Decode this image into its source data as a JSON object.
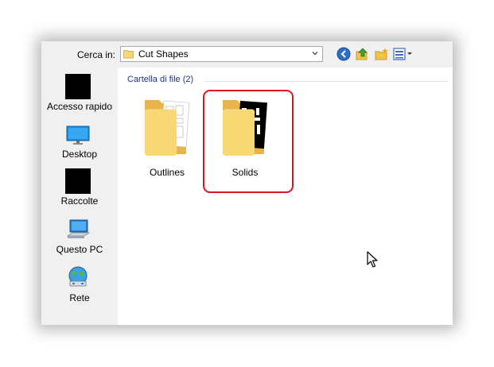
{
  "toolbar": {
    "look_in_label": "Cerca in:",
    "location_value": "Cut Shapes",
    "buttons": [
      "back-icon",
      "up-folder-icon",
      "new-folder-icon",
      "view-menu-icon"
    ]
  },
  "sidebar": {
    "items": [
      {
        "label": "Accesso rapido",
        "icon": "quick-access-icon"
      },
      {
        "label": "Desktop",
        "icon": "desktop-icon"
      },
      {
        "label": "Raccolte",
        "icon": "libraries-icon"
      },
      {
        "label": "Questo PC",
        "icon": "computer-icon"
      },
      {
        "label": "Rete",
        "icon": "network-icon"
      }
    ]
  },
  "content": {
    "group_header": "Cartella di file (2)",
    "items": [
      {
        "name": "Outlines",
        "icon": "folder-outlines-icon"
      },
      {
        "name": "Solids",
        "icon": "folder-solids-icon"
      }
    ]
  },
  "colors": {
    "highlight": "#e1141e",
    "group_header": "#1e3287",
    "folder": "#f8d775"
  }
}
